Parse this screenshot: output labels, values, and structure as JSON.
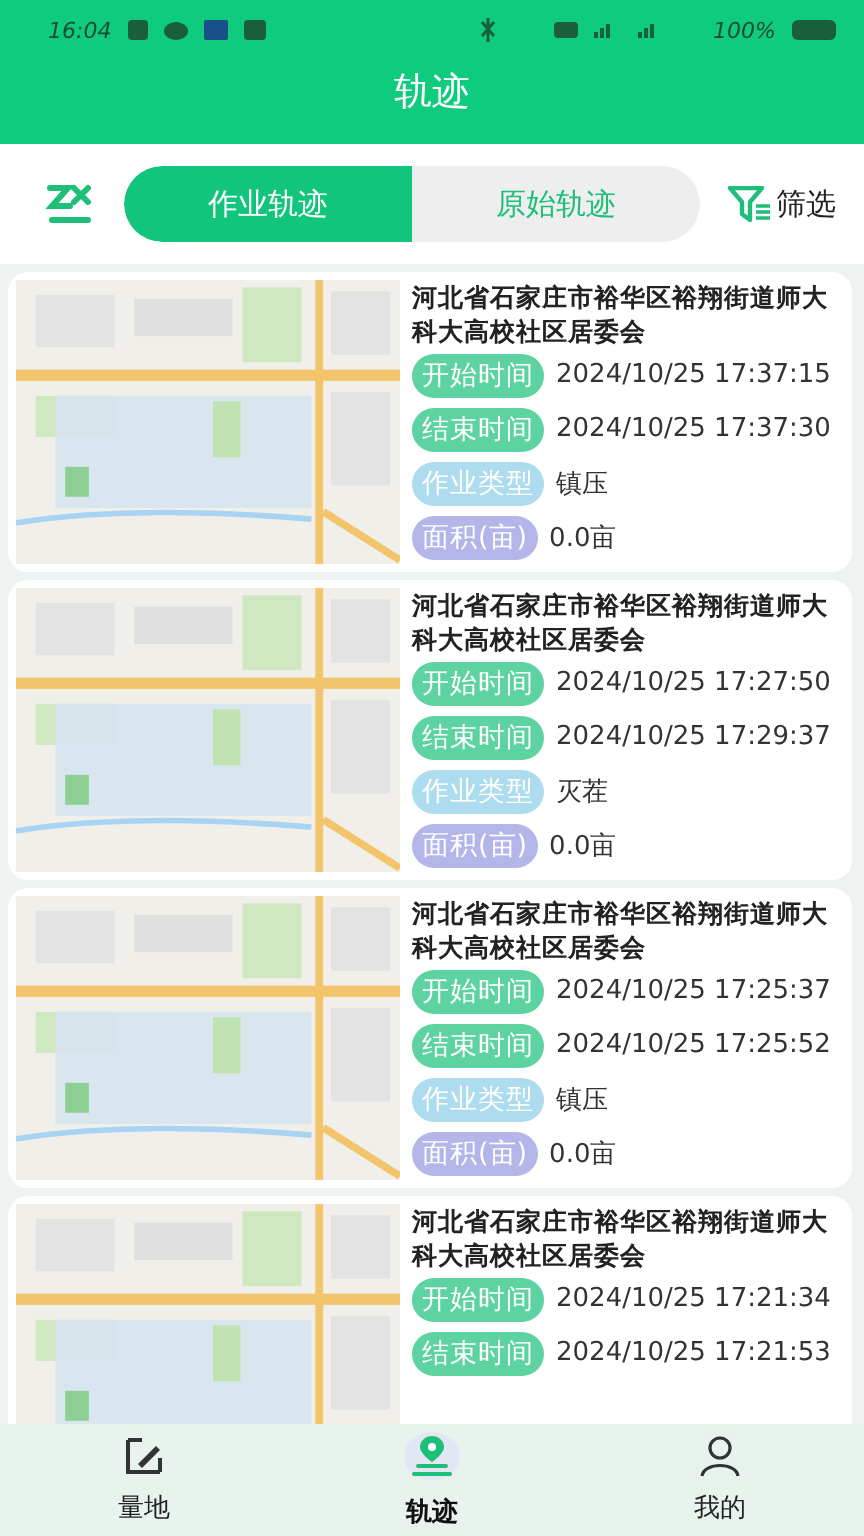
{
  "status_bar": {
    "time": "16:04",
    "battery": "100%"
  },
  "header": {
    "title": "轨迹"
  },
  "segments": [
    {
      "label": "作业轨迹",
      "selected": true
    },
    {
      "label": "原始轨迹",
      "selected": false
    }
  ],
  "filter": {
    "label": "筛选"
  },
  "records": [
    {
      "address": "河北省石家庄市裕华区裕翔街道师大科大高校社区居委会",
      "fields": [
        {
          "kind": "start",
          "label": "开始时间",
          "value": "2024/10/25 17:37:15"
        },
        {
          "kind": "end",
          "label": "结束时间",
          "value": "2024/10/25 17:37:30"
        },
        {
          "kind": "type",
          "label": "作业类型",
          "value": "镇压"
        },
        {
          "kind": "area",
          "label": "面积(亩)",
          "value": "0.0亩"
        }
      ]
    },
    {
      "address": "河北省石家庄市裕华区裕翔街道师大科大高校社区居委会",
      "fields": [
        {
          "kind": "start",
          "label": "开始时间",
          "value": "2024/10/25 17:27:50"
        },
        {
          "kind": "end",
          "label": "结束时间",
          "value": "2024/10/25 17:29:37"
        },
        {
          "kind": "type",
          "label": "作业类型",
          "value": "灭茬"
        },
        {
          "kind": "area",
          "label": "面积(亩)",
          "value": "0.0亩"
        }
      ]
    },
    {
      "address": "河北省石家庄市裕华区裕翔街道师大科大高校社区居委会",
      "fields": [
        {
          "kind": "start",
          "label": "开始时间",
          "value": "2024/10/25 17:25:37"
        },
        {
          "kind": "end",
          "label": "结束时间",
          "value": "2024/10/25 17:25:52"
        },
        {
          "kind": "type",
          "label": "作业类型",
          "value": "镇压"
        },
        {
          "kind": "area",
          "label": "面积(亩)",
          "value": "0.0亩"
        }
      ]
    },
    {
      "address": "河北省石家庄市裕华区裕翔街道师大科大高校社区居委会",
      "fields": [
        {
          "kind": "start",
          "label": "开始时间",
          "value": "2024/10/25 17:21:34"
        },
        {
          "kind": "end",
          "label": "结束时间",
          "value": "2024/10/25 17:21:53"
        }
      ]
    }
  ],
  "nav": [
    {
      "kind": "measure",
      "label": "量地",
      "selected": false
    },
    {
      "kind": "track",
      "label": "轨迹",
      "selected": true
    },
    {
      "kind": "mine",
      "label": "我的",
      "selected": false
    }
  ]
}
